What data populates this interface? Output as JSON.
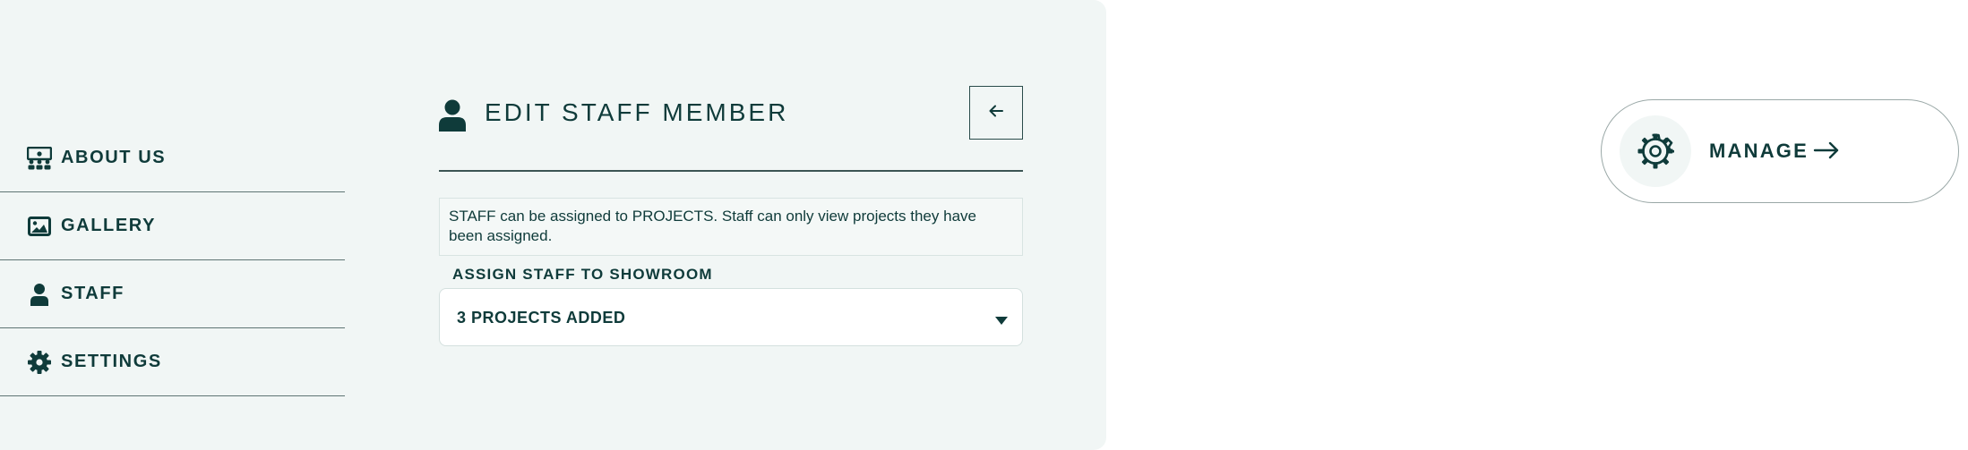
{
  "sidebar": {
    "items": [
      {
        "label": "ABOUT US",
        "icon": "team-icon"
      },
      {
        "label": "GALLERY",
        "icon": "image-icon"
      },
      {
        "label": "STAFF",
        "icon": "user-icon"
      },
      {
        "label": "SETTINGS",
        "icon": "gear-icon"
      }
    ]
  },
  "header": {
    "title": "EDIT STAFF MEMBER",
    "back_icon": "arrow-left-icon"
  },
  "form": {
    "info_text": "STAFF can be assigned to PROJECTS. Staff can only view projects they have been assigned.",
    "assign_label": "ASSIGN STAFF TO SHOWROOM",
    "assign_value": "3 PROJECTS ADDED"
  },
  "manage": {
    "label": "MANAGE",
    "icon": "gear-icon"
  },
  "colors": {
    "primary": "#0f3b3a",
    "panel_bg": "#f1f6f5"
  }
}
